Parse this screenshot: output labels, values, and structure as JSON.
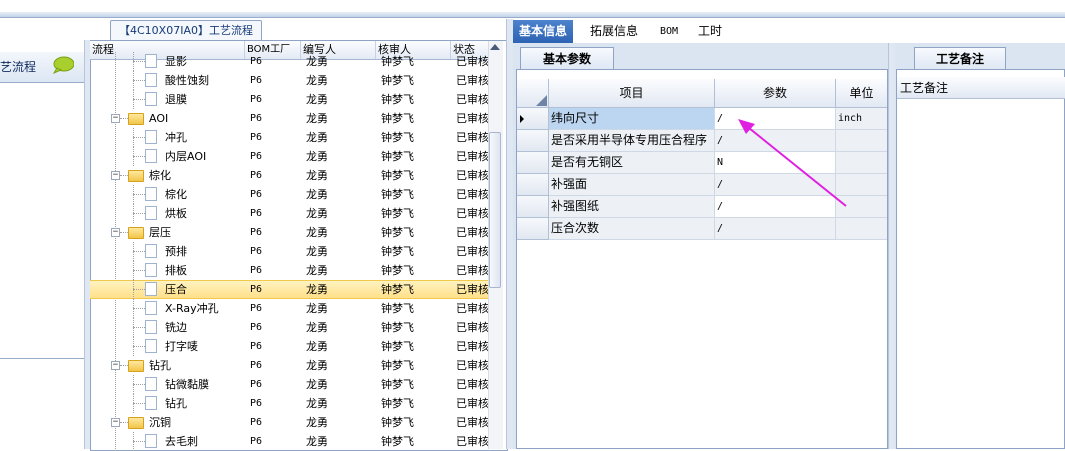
{
  "left_panel": {
    "title": "艺流程",
    "icon": "speech-bubble-icon"
  },
  "flow_tab": {
    "label": "【4C10X07IA0】工艺流程"
  },
  "tree_grid": {
    "columns": [
      "流程",
      "BOM工厂",
      "编写人",
      "核审人",
      "状态"
    ],
    "rows": [
      {
        "name": "显影",
        "factory": "P6",
        "writer": "龙勇",
        "reviewer": "钟梦飞",
        "status": "已审核",
        "type": "file"
      },
      {
        "name": "酸性蚀刻",
        "factory": "P6",
        "writer": "龙勇",
        "reviewer": "钟梦飞",
        "status": "已审核",
        "type": "file"
      },
      {
        "name": "退膜",
        "factory": "P6",
        "writer": "龙勇",
        "reviewer": "钟梦飞",
        "status": "已审核",
        "type": "file"
      },
      {
        "name": "AOI",
        "factory": "P6",
        "writer": "龙勇",
        "reviewer": "钟梦飞",
        "status": "已审核",
        "type": "folder"
      },
      {
        "name": "冲孔",
        "factory": "P6",
        "writer": "龙勇",
        "reviewer": "钟梦飞",
        "status": "已审核",
        "type": "file"
      },
      {
        "name": "内层AOI",
        "factory": "P6",
        "writer": "龙勇",
        "reviewer": "钟梦飞",
        "status": "已审核",
        "type": "file"
      },
      {
        "name": "棕化",
        "factory": "P6",
        "writer": "龙勇",
        "reviewer": "钟梦飞",
        "status": "已审核",
        "type": "folder"
      },
      {
        "name": "棕化",
        "factory": "P6",
        "writer": "龙勇",
        "reviewer": "钟梦飞",
        "status": "已审核",
        "type": "file"
      },
      {
        "name": "烘板",
        "factory": "P6",
        "writer": "龙勇",
        "reviewer": "钟梦飞",
        "status": "已审核",
        "type": "file"
      },
      {
        "name": "层压",
        "factory": "P6",
        "writer": "龙勇",
        "reviewer": "钟梦飞",
        "status": "已审核",
        "type": "folder"
      },
      {
        "name": "预排",
        "factory": "P6",
        "writer": "龙勇",
        "reviewer": "钟梦飞",
        "status": "已审核",
        "type": "file"
      },
      {
        "name": "排板",
        "factory": "P6",
        "writer": "龙勇",
        "reviewer": "钟梦飞",
        "status": "已审核",
        "type": "file"
      },
      {
        "name": "压合",
        "factory": "P6",
        "writer": "龙勇",
        "reviewer": "钟梦飞",
        "status": "已审核",
        "type": "file"
      },
      {
        "name": "X-Ray冲孔",
        "factory": "P6",
        "writer": "龙勇",
        "reviewer": "钟梦飞",
        "status": "已审核",
        "type": "file"
      },
      {
        "name": "铣边",
        "factory": "P6",
        "writer": "龙勇",
        "reviewer": "钟梦飞",
        "status": "已审核",
        "type": "file"
      },
      {
        "name": "打字唛",
        "factory": "P6",
        "writer": "龙勇",
        "reviewer": "钟梦飞",
        "status": "已审核",
        "type": "file"
      },
      {
        "name": "钻孔",
        "factory": "P6",
        "writer": "龙勇",
        "reviewer": "钟梦飞",
        "status": "已审核",
        "type": "folder"
      },
      {
        "name": "钻微黏膜",
        "factory": "P6",
        "writer": "龙勇",
        "reviewer": "钟梦飞",
        "status": "已审核",
        "type": "file"
      },
      {
        "name": "钻孔",
        "factory": "P6",
        "writer": "龙勇",
        "reviewer": "钟梦飞",
        "status": "已审核",
        "type": "file"
      },
      {
        "name": "沉铜",
        "factory": "P6",
        "writer": "龙勇",
        "reviewer": "钟梦飞",
        "status": "已审核",
        "type": "folder"
      },
      {
        "name": "去毛刺",
        "factory": "P6",
        "writer": "龙勇",
        "reviewer": "钟梦飞",
        "status": "已审核",
        "type": "file"
      }
    ],
    "selected_row": "压合"
  },
  "main_tabs": [
    {
      "label": "基本信息",
      "active": true
    },
    {
      "label": "拓展信息",
      "active": false
    },
    {
      "label": "BOM",
      "active": false
    },
    {
      "label": "工时",
      "active": false
    }
  ],
  "params": {
    "subtab": "基本参数",
    "headers": {
      "item": "项目",
      "value": "参数",
      "unit": "单位"
    },
    "rows": [
      {
        "item": "纬向尺寸",
        "value": "/",
        "unit": "inch"
      },
      {
        "item": "是否采用半导体专用压合程序",
        "value": "/",
        "unit": ""
      },
      {
        "item": "是否有无铜区",
        "value": "N",
        "unit": ""
      },
      {
        "item": "补强面",
        "value": "/",
        "unit": ""
      },
      {
        "item": "补强图纸",
        "value": "/",
        "unit": ""
      },
      {
        "item": "压合次数",
        "value": "/",
        "unit": ""
      }
    ]
  },
  "notes": {
    "tab": "工艺备注",
    "header": "工艺备注"
  },
  "colors": {
    "accent_tab": "#2d63b3",
    "annotation_arrow": "#e020e0",
    "selected_row": "#ffe08a"
  }
}
